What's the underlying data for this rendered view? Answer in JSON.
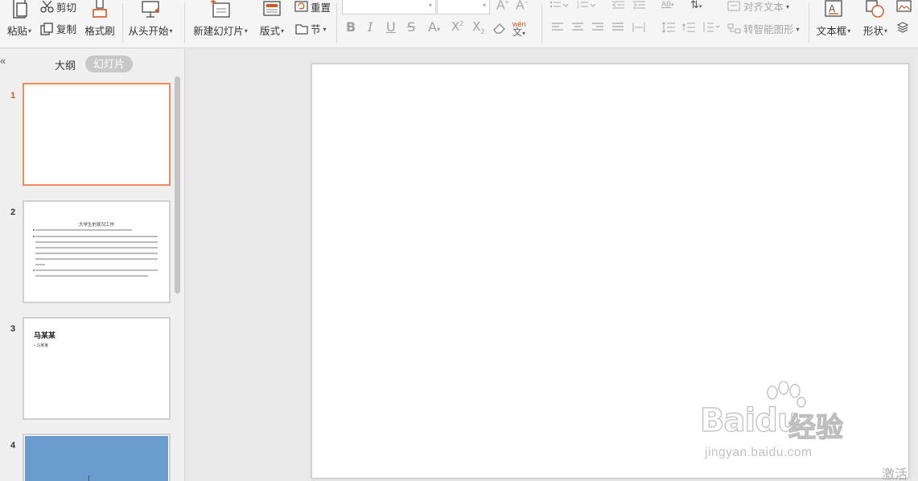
{
  "ribbon": {
    "paste_label": "粘贴",
    "cut_label": "剪切",
    "copy_label": "复制",
    "format_painter_label": "格式刷",
    "from_start_label": "从头开始",
    "new_slide_label": "新建幻灯片",
    "layout_label": "版式",
    "reset_label": "重置",
    "section_label": "节",
    "align_text_label": "对齐文本",
    "smart_art_label": "转智能图形",
    "textbox_label": "文本框",
    "shape_label": "形状",
    "font_name_value": "",
    "font_size_value": "",
    "pinyin_glyph": "wén",
    "ab_glyph": "AB"
  },
  "panel": {
    "tab_outline": "大纲",
    "tab_slides": "幻灯片",
    "slides": [
      {
        "number": "1",
        "active": true
      },
      {
        "number": "2",
        "title": "大学生的现况工作"
      },
      {
        "number": "3",
        "title": "马某某",
        "subtitle": "• 马某某"
      },
      {
        "number": "4"
      }
    ]
  },
  "watermark": {
    "brand": "Baidu",
    "brand_cn": "经验",
    "url": "jingyan.baidu.com"
  },
  "status": {
    "activate_text": "激活"
  },
  "colors": {
    "active_slide_border": "#f08a5d",
    "active_number": "#d5561f",
    "slide4_fill": "#6b9ccf"
  }
}
